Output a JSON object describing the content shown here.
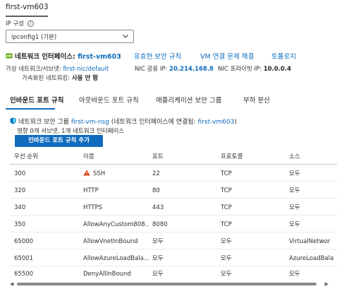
{
  "title": "first-vm603",
  "ip_config": {
    "label": "IP 구성",
    "selected": "ipconfig1 (기본)"
  },
  "nic": {
    "label": "네트워크 인터페이스:",
    "name": "first-vm603",
    "links": [
      "유효한 보안 규칙",
      "VM 연결 문제 해결",
      "토폴로지"
    ],
    "vnet_label": "가상 네트워크/서브넷:",
    "vnet_value": "first-nic/default",
    "public_ip_label": "NIC 공용 IP:",
    "public_ip": "20.214.168.8",
    "private_ip_label": "NIC 프라이빗 IP:",
    "private_ip": "10.0.0.4",
    "accel_label": "가속화된 네트워킹:",
    "accel_value": "사용 안 함"
  },
  "tabs": [
    "인바운드 포트 규칙",
    "아웃바운드 포트 규칙",
    "애플리케이션 보안 그룹",
    "부하 분산"
  ],
  "nsg": {
    "prefix": "네트워크 보안 그룹",
    "name": "first-vm-nsg",
    "attached_prefix": "(네트워크 인터페이스에 연결됨:",
    "attached_name": "first-vm603",
    "attached_suffix": ")",
    "impact": "영향 0개 서브넷, 1개 네트워크 인터페이스"
  },
  "add_button": "인바운드 포트 규칙 추가",
  "table": {
    "headers": [
      "우선 순위",
      "이름",
      "포트",
      "프로토콜",
      "소스"
    ],
    "rows": [
      [
        "300",
        "SSH",
        "22",
        "TCP",
        "모두"
      ],
      [
        "320",
        "HTTP",
        "80",
        "TCP",
        "모두"
      ],
      [
        "340",
        "HTTPS",
        "443",
        "TCP",
        "모두"
      ],
      [
        "350",
        "AllowAnyCustom808...",
        "8080",
        "TCP",
        "모두"
      ],
      [
        "65000",
        "AllowVnetInBound",
        "모두",
        "모두",
        "VirtualNetwor"
      ],
      [
        "65001",
        "AllowAzureLoadBala...",
        "모두",
        "모두",
        "AzureLoadBala"
      ],
      [
        "65500",
        "DenyAllInBound",
        "모두",
        "모두",
        "모두"
      ]
    ]
  },
  "colors": {
    "accent": "#0f6cbd",
    "warning": "#d83b01",
    "nic_icon": "#57a300"
  },
  "icons": {
    "info": "info-icon",
    "nic": "network-interface-icon",
    "nsg": "shield-icon",
    "warning": "warning-icon",
    "dropdown": "chevron-down-icon"
  }
}
